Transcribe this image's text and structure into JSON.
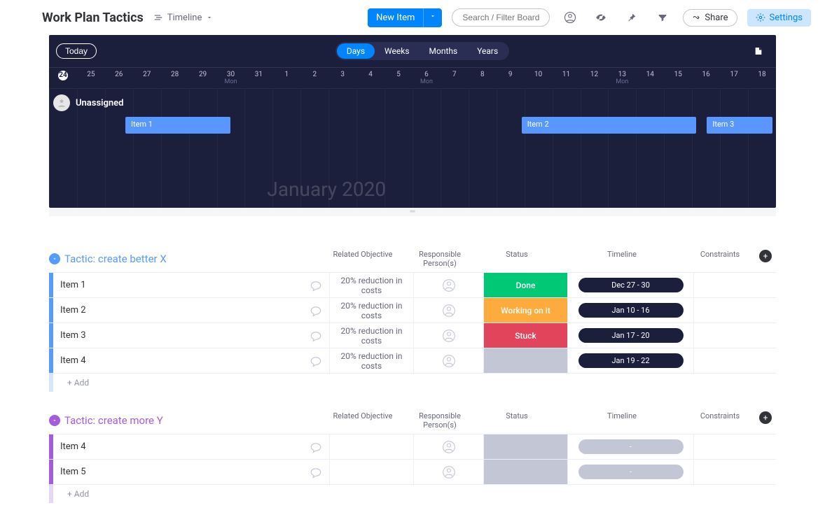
{
  "header": {
    "board_title": "Work Plan Tactics",
    "view_label": "Timeline",
    "new_item_label": "New Item",
    "search_placeholder": "Search / Filter Board",
    "share_label": "Share",
    "settings_label": "Settings"
  },
  "timeline": {
    "today_label": "Today",
    "views": [
      "Days",
      "Weeks",
      "Months",
      "Years"
    ],
    "active_view": "Days",
    "days": [
      "24",
      "25",
      "26",
      "27",
      "28",
      "29",
      "30",
      "31",
      "1",
      "2",
      "3",
      "4",
      "5",
      "6",
      "7",
      "8",
      "9",
      "10",
      "11",
      "12",
      "13",
      "14",
      "15",
      "16",
      "17",
      "18"
    ],
    "mon_indices": [
      6,
      13,
      20
    ],
    "month_label": "January 2020",
    "swimlanes": [
      {
        "name": "Unassigned",
        "bars": [
          {
            "label": "Item 1",
            "left_pct": 10.5,
            "width_pct": 14.5
          },
          {
            "label": "Item 2",
            "left_pct": 65,
            "width_pct": 24
          },
          {
            "label": "Item 3",
            "left_pct": 90.5,
            "width_pct": 9
          }
        ]
      }
    ]
  },
  "groups": [
    {
      "title": "Tactic: create better X",
      "color": "#579bfc",
      "columns": [
        "Related Objective",
        "Responsible Person(s)",
        "Status",
        "Timeline",
        "Constraints"
      ],
      "items": [
        {
          "name": "Item 1",
          "objective": "20% reduction in costs",
          "status_label": "Done",
          "status_class": "status-done",
          "timeline": "Dec 27 - 30"
        },
        {
          "name": "Item 2",
          "objective": "20% reduction in costs",
          "status_label": "Working on it",
          "status_class": "status-working",
          "timeline": "Jan 10 - 16"
        },
        {
          "name": "Item 3",
          "objective": "20% reduction in costs",
          "status_label": "Stuck",
          "status_class": "status-stuck",
          "timeline": "Jan 17 - 20"
        },
        {
          "name": "Item 4",
          "objective": "20% reduction in costs",
          "status_label": "",
          "status_class": "status-empty",
          "timeline": "Jan 19 - 22"
        }
      ],
      "add_label": "+ Add"
    },
    {
      "title": "Tactic: create more Y",
      "color": "#a25ddc",
      "columns": [
        "Related Objective",
        "Responsible Person(s)",
        "Status",
        "Timeline",
        "Constraints"
      ],
      "items": [
        {
          "name": "Item 4",
          "objective": "",
          "status_label": "",
          "status_class": "status-empty",
          "timeline": "-"
        },
        {
          "name": "Item 5",
          "objective": "",
          "status_label": "",
          "status_class": "status-empty",
          "timeline": "-"
        }
      ],
      "add_label": "+ Add"
    }
  ]
}
